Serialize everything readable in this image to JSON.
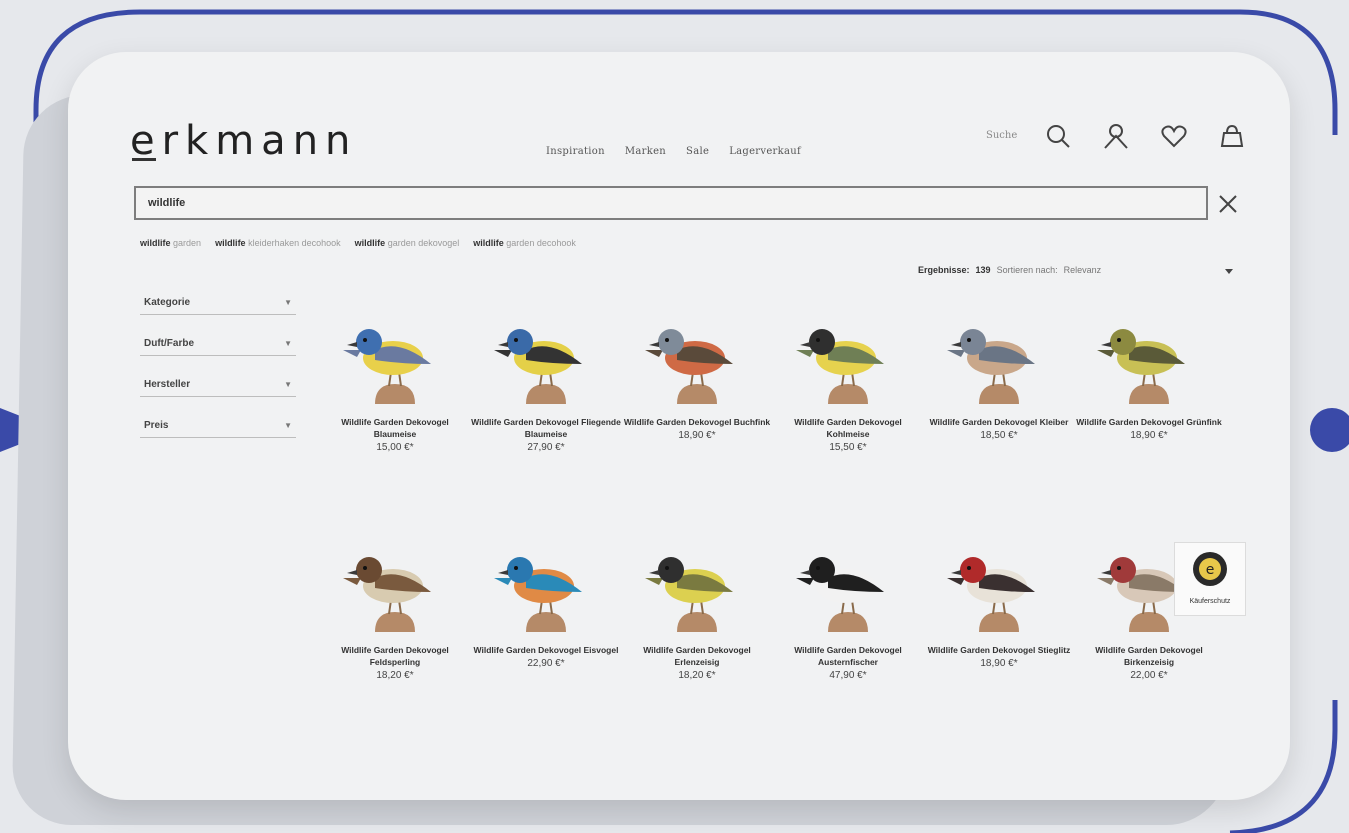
{
  "brand": {
    "logo_text": "erkmann"
  },
  "nav": {
    "items": [
      "Inspiration",
      "Marken",
      "Sale",
      "Lagerverkauf"
    ]
  },
  "header": {
    "search_label": "Suche",
    "icons": [
      "search-icon",
      "account-icon",
      "wishlist-icon",
      "cart-icon"
    ]
  },
  "search": {
    "value": "wildlife"
  },
  "suggestions": [
    {
      "bold": "wildlife",
      "rest": "garden"
    },
    {
      "bold": "wildlife",
      "rest": "kleiderhaken decohook"
    },
    {
      "bold": "wildlife",
      "rest": "garden dekovogel"
    },
    {
      "bold": "wildlife",
      "rest": "garden decohook"
    }
  ],
  "results": {
    "label": "Ergebnisse:",
    "count": "139",
    "sort_label": "Sortieren nach:",
    "sort_value": "Relevanz"
  },
  "filters": [
    "Kategorie",
    "Duft/Farbe",
    "Hersteller",
    "Preis"
  ],
  "products": [
    {
      "name": "Wildlife Garden Dekovogel Blaumeise",
      "price": "15,00 €*",
      "colors": {
        "body": "#e8d04a",
        "head": "#3f6fb0",
        "wing": "#6a7aa0"
      }
    },
    {
      "name": "Wildlife Garden Dekovogel Fliegende Blaumeise",
      "price": "27,90 €*",
      "colors": {
        "body": "#e4d048",
        "head": "#3a6aa8",
        "wing": "#333333"
      }
    },
    {
      "name": "Wildlife Garden Dekovogel Buchfink",
      "price": "18,90 €*",
      "colors": {
        "body": "#cf6a45",
        "head": "#7f8b99",
        "wing": "#5a4a3a"
      }
    },
    {
      "name": "Wildlife Garden Dekovogel Kohlmeise",
      "price": "15,50 €*",
      "colors": {
        "body": "#e6d24e",
        "head": "#2f2f2f",
        "wing": "#6f7f55"
      }
    },
    {
      "name": "Wildlife Garden Dekovogel Kleiber",
      "price": "18,50 €*",
      "colors": {
        "body": "#c9a78a",
        "head": "#7a8595",
        "wing": "#6a7585"
      }
    },
    {
      "name": "Wildlife Garden Dekovogel Grünfink",
      "price": "18,90 €*",
      "colors": {
        "body": "#c8c055",
        "head": "#8c8a40",
        "wing": "#5a5a38"
      }
    },
    {
      "name": "Wildlife Garden Dekovogel Feldsperling",
      "price": "18,20 €*",
      "colors": {
        "body": "#d8cbb0",
        "head": "#6a4a32",
        "wing": "#7a5a3e"
      }
    },
    {
      "name": "Wildlife Garden Dekovogel Eisvogel",
      "price": "22,90 €*",
      "colors": {
        "body": "#e08a45",
        "head": "#2a78b0",
        "wing": "#2a8ab8"
      }
    },
    {
      "name": "Wildlife Garden Dekovogel Erlenzeisig",
      "price": "18,20 €*",
      "colors": {
        "body": "#dcd050",
        "head": "#2f2f2f",
        "wing": "#7a7a40"
      }
    },
    {
      "name": "Wildlife Garden Dekovogel Austernfischer",
      "price": "47,90 €*",
      "colors": {
        "body": "#f2f2f2",
        "head": "#1f1f1f",
        "wing": "#1f1f1f"
      }
    },
    {
      "name": "Wildlife Garden Dekovogel Stieglitz",
      "price": "18,90 €*",
      "colors": {
        "body": "#e8e2d8",
        "head": "#b02a2a",
        "wing": "#3a3030"
      }
    },
    {
      "name": "Wildlife Garden Dekovogel Birkenzeisig",
      "price": "22,00 €*",
      "colors": {
        "body": "#d8c8b8",
        "head": "#a03a3a",
        "wing": "#8a7a68"
      }
    }
  ],
  "trust_badge": {
    "label": "Käuferschutz"
  },
  "theme": {
    "frame_accent": "#3a4aa8"
  }
}
